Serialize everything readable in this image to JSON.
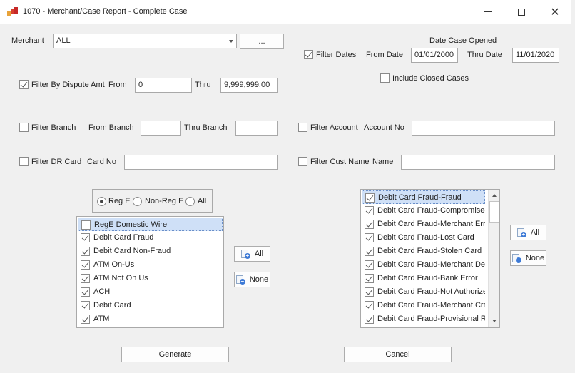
{
  "window": {
    "title": "1070 - Merchant/Case Report - Complete Case",
    "minimize_icon": "minimize-icon",
    "maximize_icon": "maximize-icon",
    "close_icon": "close-icon",
    "close_glyph": "✕"
  },
  "merchant": {
    "label": "Merchant",
    "value": "ALL",
    "browse_label": "..."
  },
  "date_filter": {
    "section_label": "Date Case Opened",
    "filter_label": "Filter Dates",
    "filter_checked": true,
    "from_label": "From Date",
    "from_value": "01/01/2000",
    "thru_label": "Thru Date",
    "thru_value": "11/01/2020",
    "include_closed_label": "Include Closed Cases",
    "include_closed_checked": false
  },
  "dispute_filter": {
    "label": "Filter By Dispute Amt",
    "checked": true,
    "from_label": "From",
    "from_value": "0",
    "thru_label": "Thru",
    "thru_value": "9,999,999.00"
  },
  "branch_filter": {
    "label": "Filter Branch",
    "checked": false,
    "from_label": "From Branch",
    "from_value": "",
    "thru_label": "Thru Branch",
    "thru_value": ""
  },
  "account_filter": {
    "label": "Filter Account",
    "checked": false,
    "account_label": "Account No",
    "account_value": ""
  },
  "dr_card_filter": {
    "label": "Filter DR Card",
    "checked": false,
    "card_label": "Card No",
    "card_value": ""
  },
  "cust_name_filter": {
    "label": "Filter Cust Name",
    "checked": false,
    "name_label": "Name",
    "name_value": ""
  },
  "reg_options": {
    "options": [
      "Reg E",
      "Non-Reg E",
      "All"
    ],
    "selected": "Reg E"
  },
  "case_types": {
    "items": [
      {
        "label": "RegE Domestic Wire",
        "checked": false
      },
      {
        "label": "Debit Card Fraud",
        "checked": true
      },
      {
        "label": "Debit Card Non-Fraud",
        "checked": true
      },
      {
        "label": "ATM On-Us",
        "checked": true
      },
      {
        "label": "ATM Not On Us",
        "checked": true
      },
      {
        "label": "ACH",
        "checked": true
      },
      {
        "label": "Debit Card",
        "checked": true
      },
      {
        "label": "ATM",
        "checked": true
      }
    ],
    "all_label": "All",
    "none_label": "None"
  },
  "reasons": {
    "items": [
      {
        "label": "Debit Card Fraud-Fraud",
        "checked": true
      },
      {
        "label": "Debit Card Fraud-Compromised",
        "checked": true
      },
      {
        "label": "Debit Card Fraud-Merchant Erro",
        "checked": true
      },
      {
        "label": "Debit Card Fraud-Lost Card",
        "checked": true
      },
      {
        "label": "Debit Card Fraud-Stolen Card",
        "checked": true
      },
      {
        "label": "Debit Card Fraud-Merchant Den",
        "checked": true
      },
      {
        "label": "Debit Card Fraud-Bank Error",
        "checked": true
      },
      {
        "label": "Debit Card Fraud-Not Authorize",
        "checked": true
      },
      {
        "label": "Debit Card Fraud-Merchant Cre",
        "checked": true
      },
      {
        "label": "Debit Card Fraud-Provisional Re",
        "checked": true
      }
    ],
    "all_label": "All",
    "none_label": "None"
  },
  "actions": {
    "generate_label": "Generate",
    "cancel_label": "Cancel"
  }
}
